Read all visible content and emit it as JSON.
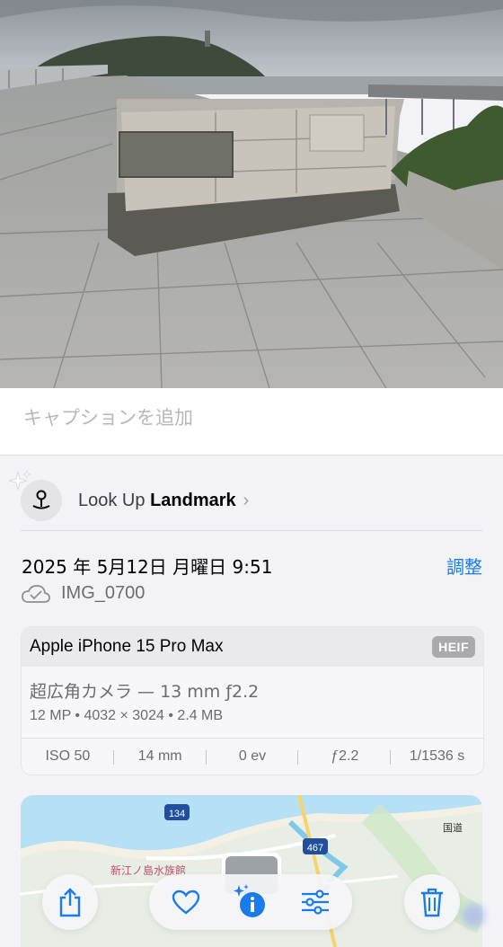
{
  "caption": {
    "placeholder": "キャプションを追加"
  },
  "lookup": {
    "prefix": "Look Up",
    "subject": "Landmark",
    "chevron": "›"
  },
  "meta": {
    "datetime": "2025 年 5月12日 月曜日 9:51",
    "adjust_label": "調整",
    "filename": "IMG_0700"
  },
  "camera": {
    "model": "Apple iPhone 15 Pro Max",
    "format_badge": "HEIF",
    "lens": "超広角カメラ — 13 mm ƒ2.2",
    "specs": "12 MP • 4032 × 3024 • 2.4 MB",
    "exif": [
      "ISO 50",
      "14 mm",
      "0 ev",
      "ƒ2.2",
      "1/1536 s"
    ]
  },
  "map": {
    "road_1": "134",
    "road_2": "467",
    "place": "新江ノ島水族館",
    "road_vertical": "国道"
  },
  "toolbar": {
    "share": "share-icon",
    "favorite": "heart-icon",
    "info": "info-sparkle-icon",
    "adjust": "sliders-icon",
    "delete": "trash-icon"
  },
  "colors": {
    "accent": "#1a7bea",
    "background": "#f2f2f7"
  }
}
